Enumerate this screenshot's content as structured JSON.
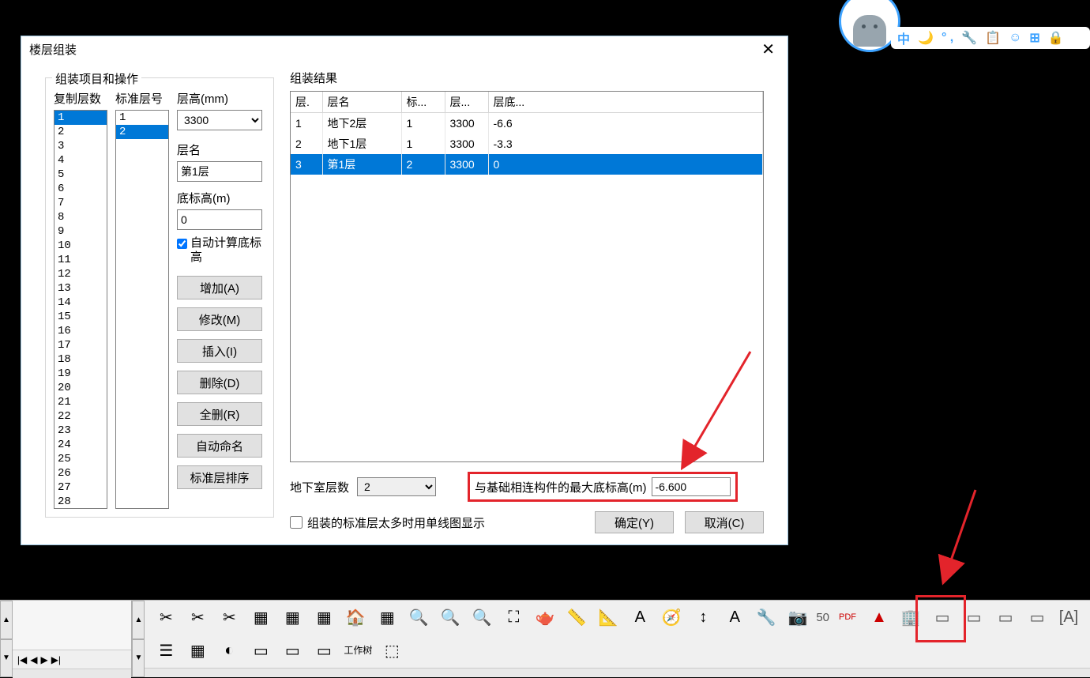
{
  "dialog": {
    "title": "楼层组装",
    "left_panel_title": "组装项目和操作",
    "copy_header": "复制层数",
    "std_header": "标准层号",
    "height_label": "层高(mm)",
    "height_value": "3300",
    "name_label": "层名",
    "name_value": "第1层",
    "elev_label": "底标高(m)",
    "elev_value": "0",
    "auto_calc_label": "自动计算底标高",
    "auto_calc_checked": true,
    "buttons": {
      "add": "增加(A)",
      "modify": "修改(M)",
      "insert": "插入(I)",
      "delete": "删除(D)",
      "clear": "全删(R)",
      "autoname": "自动命名",
      "stdsort": "标准层排序"
    },
    "copy_items": [
      "1",
      "2",
      "3",
      "4",
      "5",
      "6",
      "7",
      "8",
      "9",
      "10",
      "11",
      "12",
      "13",
      "14",
      "15",
      "16",
      "17",
      "18",
      "19",
      "20",
      "21",
      "22",
      "23",
      "24",
      "25",
      "26",
      "27",
      "28"
    ],
    "copy_selected_index": 0,
    "std_items": [
      "1",
      "2"
    ],
    "std_selected_index": 1
  },
  "result": {
    "title": "组装结果",
    "headers": [
      "层.",
      "层名",
      "标...",
      "层...",
      "层底..."
    ],
    "rows": [
      {
        "idx": "1",
        "name": "地下2层",
        "std": "1",
        "h": "3300",
        "elev": "-6.6",
        "selected": false
      },
      {
        "idx": "2",
        "name": "地下1层",
        "std": "1",
        "h": "3300",
        "elev": "-3.3",
        "selected": false
      },
      {
        "idx": "3",
        "name": "第1层",
        "std": "2",
        "h": "3300",
        "elev": "0",
        "selected": true
      }
    ]
  },
  "bottom": {
    "basement_label": "地下室层数",
    "basement_value": "2",
    "max_elev_label": "与基础相连构件的最大底标高(m)",
    "max_elev_value": "-6.600",
    "singleline_label": "组装的标准层太多时用单线图显示",
    "singleline_checked": false,
    "ok": "确定(Y)",
    "cancel": "取消(C)"
  },
  "ime": {
    "items": [
      "中",
      "🌙",
      "° ,",
      "🔧",
      "📋",
      "☺",
      "⊞",
      "🔒"
    ]
  },
  "toolbar": {
    "row1_icons": [
      "cut",
      "copy",
      "paste",
      "cube",
      "cube-view",
      "cubes",
      "house",
      "cube2",
      "search",
      "zoom-out",
      "zoom-fit",
      "crop",
      "teapot",
      "ruler",
      "caliper",
      "compass",
      "compass2",
      "height",
      "text",
      "cam",
      "camera"
    ],
    "fifty": "50",
    "row1_icons_right": [
      "pdf",
      "dwg",
      "building",
      "layers",
      "survey",
      "mark",
      "annotate",
      "text2"
    ],
    "row2_icons": [
      "list",
      "3d",
      "pie",
      "window1",
      "window2",
      "window3"
    ],
    "work_tree": "工作树",
    "row2_last": "last"
  }
}
